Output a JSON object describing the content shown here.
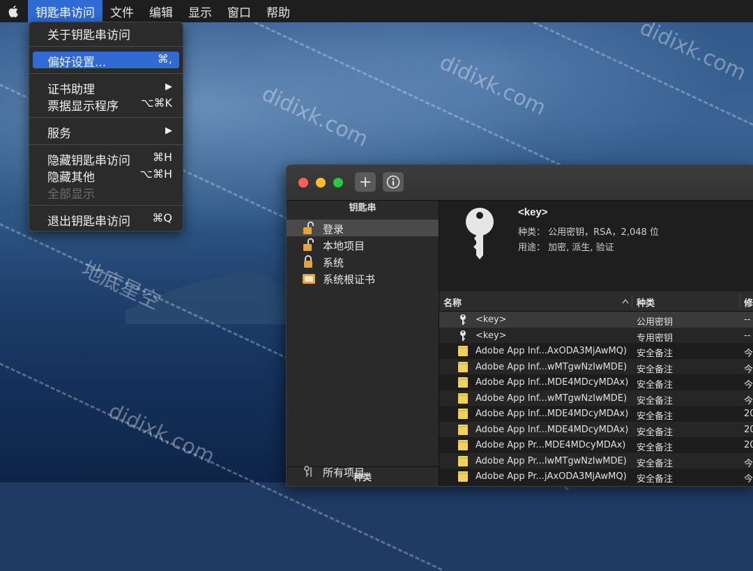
{
  "menubar": {
    "items": [
      "钥匙串访问",
      "文件",
      "编辑",
      "显示",
      "窗口",
      "帮助"
    ]
  },
  "app_menu": {
    "about": "关于钥匙串访问",
    "preferences": "偏好设置...",
    "preferences_shortcut": "⌘,",
    "cert_assistant": "证书助理",
    "ticket_viewer": "票据显示程序",
    "ticket_viewer_shortcut": "⌥⌘K",
    "services": "服务",
    "hide_app": "隐藏钥匙串访问",
    "hide_app_shortcut": "⌘H",
    "hide_others": "隐藏其他",
    "hide_others_shortcut": "⌥⌘H",
    "show_all": "全部显示",
    "quit": "退出钥匙串访问",
    "quit_shortcut": "⌘Q",
    "submenu_arrow": "▶"
  },
  "sidebar": {
    "keychains_header": "钥匙串",
    "keychains": [
      "登录",
      "本地项目",
      "系统",
      "系统根证书"
    ],
    "category_header": "种类",
    "category_first": "所有项目"
  },
  "detail": {
    "name": "<key>",
    "kind_line": "种类：  公用密钥，RSA，2,048 位",
    "usage_line": "用途：  加密, 派生, 验证"
  },
  "table": {
    "headers": {
      "name": "名称",
      "kind": "种类",
      "date": "修"
    },
    "rows": [
      {
        "icon": "key-icon",
        "name": "<key>",
        "kind": "公用密钥",
        "date": "--"
      },
      {
        "icon": "key-icon",
        "name": "<key>",
        "kind": "专用密钥",
        "date": "--"
      },
      {
        "icon": "note-icon",
        "name": "Adobe App Inf...AxODA3MjAwMQ)",
        "kind": "安全备注",
        "date": "今"
      },
      {
        "icon": "note-icon",
        "name": "Adobe App Inf...wMTgwNzIwMDE)",
        "kind": "安全备注",
        "date": "今"
      },
      {
        "icon": "note-icon",
        "name": "Adobe App Inf...MDE4MDcyMDAx)",
        "kind": "安全备注",
        "date": "今"
      },
      {
        "icon": "note-icon",
        "name": "Adobe App Inf...wMTgwNzIwMDE)",
        "kind": "安全备注",
        "date": "今"
      },
      {
        "icon": "note-icon",
        "name": "Adobe App Inf...MDE4MDcyMDAx)",
        "kind": "安全备注",
        "date": "20"
      },
      {
        "icon": "note-icon",
        "name": "Adobe App Inf...MDE4MDcyMDAx)",
        "kind": "安全备注",
        "date": "20"
      },
      {
        "icon": "note-icon",
        "name": "Adobe App Pr...MDE4MDcyMDAx)",
        "kind": "安全备注",
        "date": "20"
      },
      {
        "icon": "note-icon",
        "name": "Adobe App Pr...lwMTgwNzIwMDE)",
        "kind": "安全备注",
        "date": "今"
      },
      {
        "icon": "note-icon",
        "name": "Adobe App Pr...jAxODA3MjAwMQ)",
        "kind": "安全备注",
        "date": "今"
      }
    ]
  },
  "watermarks": {
    "domain": "didixk.com",
    "cn": "地底星空"
  },
  "colors": {
    "menu_highlight": "#2f6bd3",
    "traffic_red": "#fe5f57",
    "traffic_yellow": "#febc2e",
    "traffic_green": "#28c840",
    "note_yellow": "#f1d15c"
  }
}
